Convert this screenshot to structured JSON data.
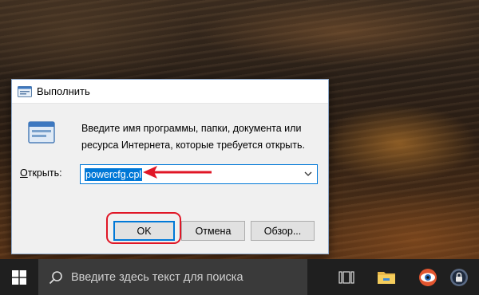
{
  "desktop": {
    "wallpaper": "sunset-over-water"
  },
  "run_dialog": {
    "title": "Выполнить",
    "description": "Введите имя программы, папки, документа или ресурса Интернета, которые требуется открыть.",
    "open_label_prefix": "О",
    "open_label_rest": "ткрыть:",
    "input_value": "powercfg.cpl",
    "buttons": {
      "ok": "OK",
      "cancel": "Отмена",
      "browse": "Обзор..."
    }
  },
  "annotations": {
    "highlight_color": "#e01626"
  },
  "taskbar": {
    "search_placeholder": "Введите здесь текст для поиска",
    "icons": [
      "windows-start-icon",
      "search-icon",
      "task-view-icon",
      "file-explorer-icon",
      "eye-app-icon",
      "lock-app-icon"
    ]
  },
  "colors": {
    "accent": "#0078d7",
    "taskbar": "#1f1f1f"
  }
}
